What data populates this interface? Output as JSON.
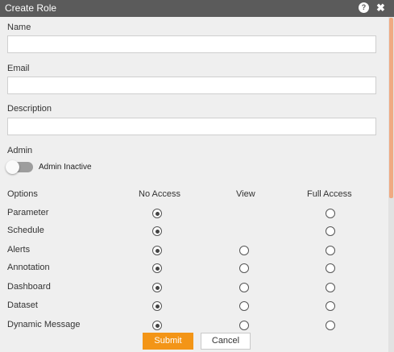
{
  "dialog": {
    "title": "Create Role",
    "help_icon": "?",
    "close_icon": "✖"
  },
  "form": {
    "name_label": "Name",
    "name_value": "",
    "email_label": "Email",
    "email_value": "",
    "description_label": "Description",
    "description_value": "",
    "admin_label": "Admin",
    "admin_toggle_label": "Admin Inactive",
    "admin_active": false
  },
  "permissions": {
    "headers": [
      "Options",
      "No Access",
      "View",
      "Full Access"
    ],
    "rows": [
      {
        "label": "Parameter",
        "selected": "No Access",
        "options": [
          "No Access",
          "Full Access"
        ]
      },
      {
        "label": "Schedule",
        "selected": "No Access",
        "options": [
          "No Access",
          "Full Access"
        ]
      },
      {
        "label": "Alerts",
        "selected": "No Access",
        "options": [
          "No Access",
          "View",
          "Full Access"
        ]
      },
      {
        "label": "Annotation",
        "selected": "No Access",
        "options": [
          "No Access",
          "View",
          "Full Access"
        ]
      },
      {
        "label": "Dashboard",
        "selected": "No Access",
        "options": [
          "No Access",
          "View",
          "Full Access"
        ]
      },
      {
        "label": "Dataset",
        "selected": "No Access",
        "options": [
          "No Access",
          "View",
          "Full Access"
        ]
      },
      {
        "label": "Dynamic Message",
        "selected": "No Access",
        "options": [
          "No Access",
          "View",
          "Full Access"
        ]
      }
    ]
  },
  "buttons": {
    "submit_label": "Submit",
    "cancel_label": "Cancel"
  },
  "colors": {
    "titlebar": "#5b5b5b",
    "accent": "#f39517",
    "scrollbar_thumb": "#f0aa82"
  }
}
